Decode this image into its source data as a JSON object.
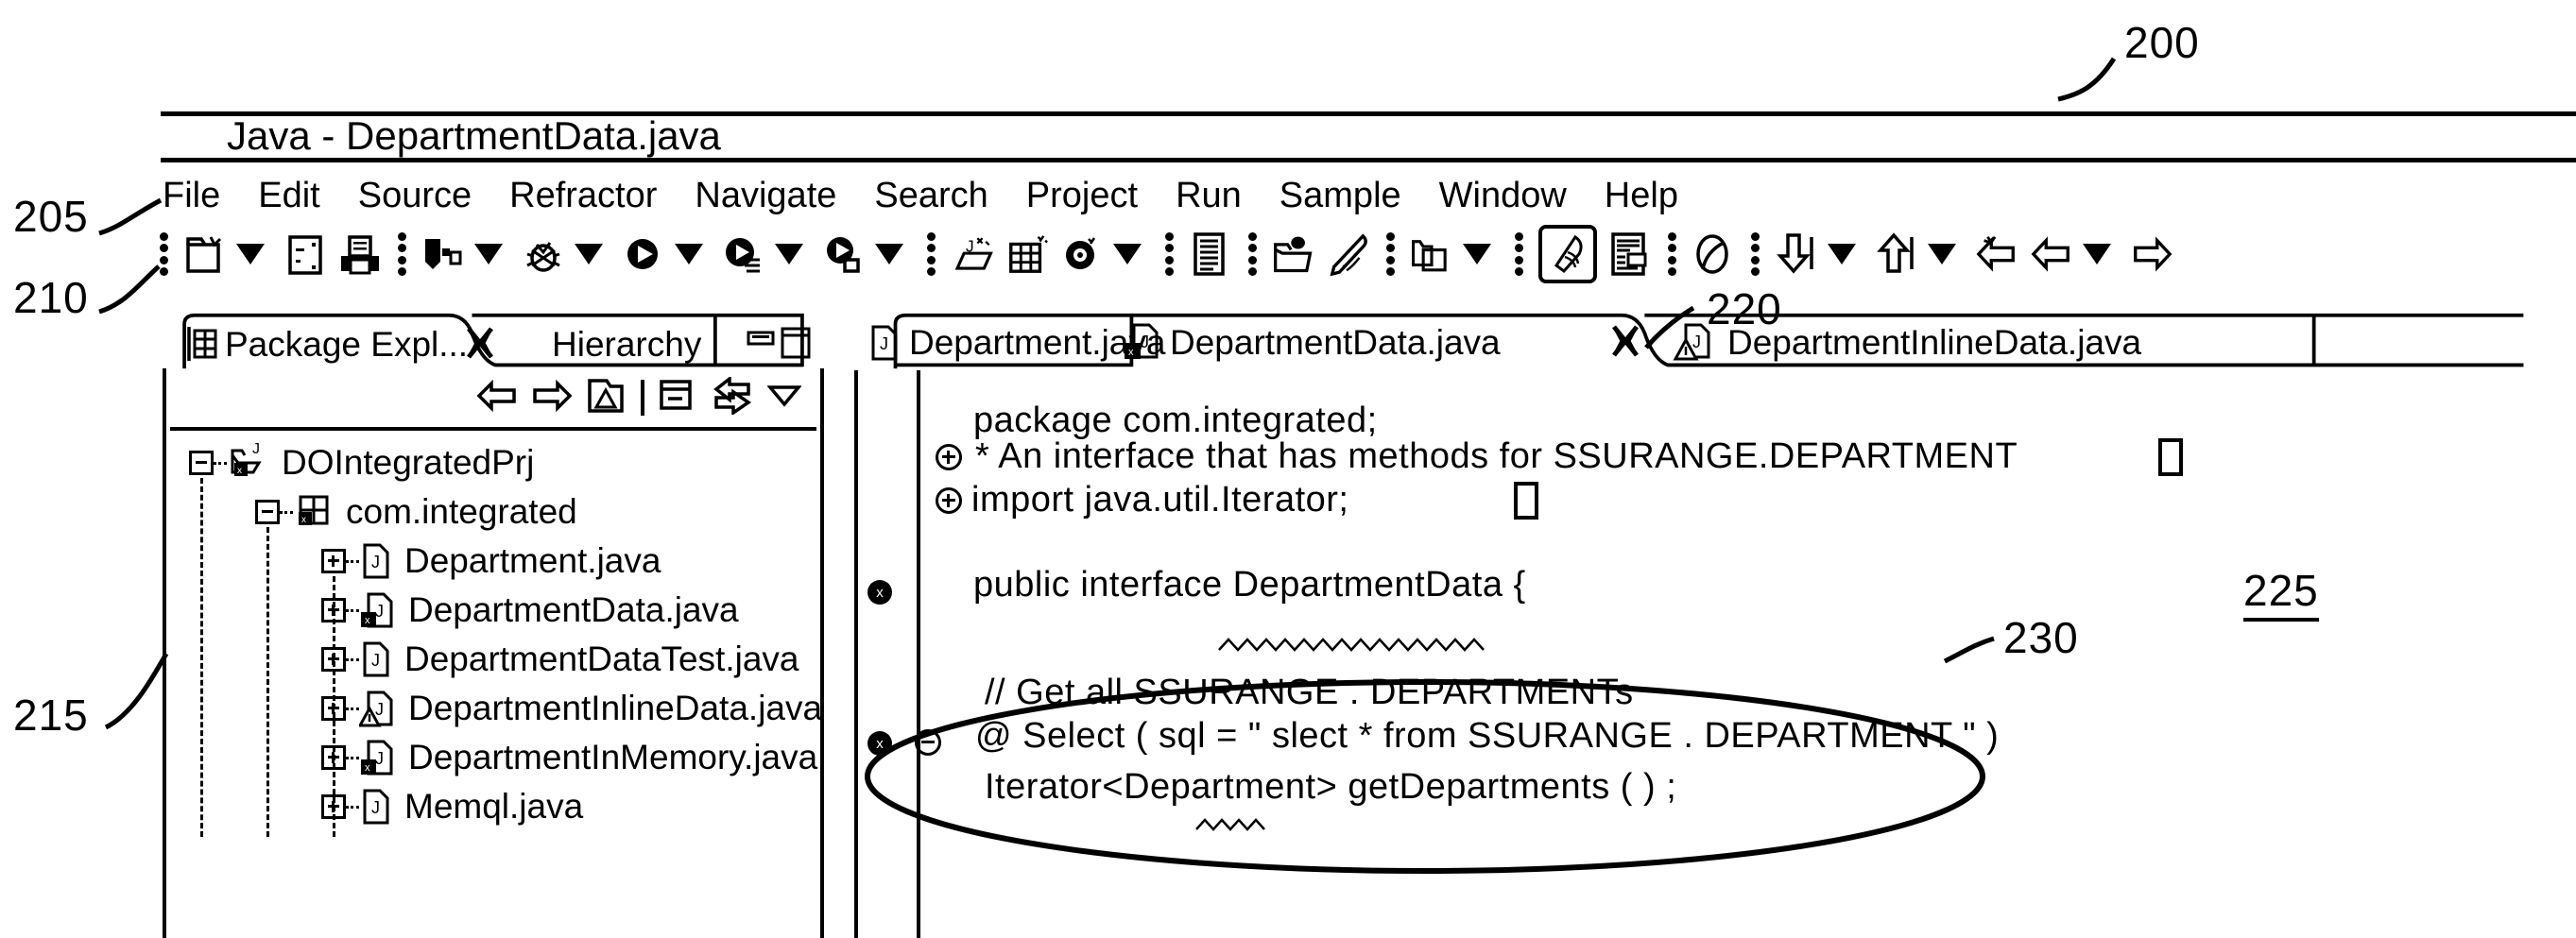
{
  "figure": {
    "refs": [
      {
        "id": "200",
        "label": "200"
      },
      {
        "id": "205",
        "label": "205"
      },
      {
        "id": "210",
        "label": "210"
      },
      {
        "id": "215",
        "label": "215"
      },
      {
        "id": "220",
        "label": "220"
      },
      {
        "id": "225",
        "label": "225"
      },
      {
        "id": "230",
        "label": "230"
      }
    ]
  },
  "window": {
    "title": "Java - DepartmentData.java"
  },
  "menubar": {
    "items": [
      {
        "label": "File"
      },
      {
        "label": "Edit"
      },
      {
        "label": "Source"
      },
      {
        "label": "Refractor"
      },
      {
        "label": "Navigate"
      },
      {
        "label": "Search"
      },
      {
        "label": "Project"
      },
      {
        "label": "Run"
      },
      {
        "label": "Sample"
      },
      {
        "label": "Window"
      },
      {
        "label": "Help"
      }
    ]
  },
  "toolbar": {
    "groups": [
      {
        "items": [
          {
            "icon": "new-wizard-icon",
            "dropdown": true
          },
          {
            "icon": "save-icon",
            "dropdown": false
          },
          {
            "icon": "print-icon",
            "dropdown": false
          }
        ]
      },
      {
        "items": [
          {
            "icon": "build-icon",
            "dropdown": true
          },
          {
            "icon": "debug-bug-icon",
            "dropdown": true
          },
          {
            "icon": "run-icon",
            "dropdown": true
          },
          {
            "icon": "run-external-tools-icon",
            "dropdown": true
          },
          {
            "icon": "profile-icon",
            "dropdown": true
          }
        ]
      },
      {
        "items": [
          {
            "icon": "new-java-class-icon",
            "dropdown": false
          },
          {
            "icon": "new-java-package-icon",
            "dropdown": false
          },
          {
            "icon": "search-target-icon",
            "dropdown": true
          },
          {
            "icon": "open-type-icon",
            "dropdown": false
          }
        ]
      },
      {
        "items": [
          {
            "icon": "open-folder-icon",
            "dropdown": false
          },
          {
            "icon": "pen-annotate-icon",
            "dropdown": false
          }
        ]
      },
      {
        "items": [
          {
            "icon": "open-resource-icon",
            "dropdown": true
          }
        ]
      },
      {
        "items": [
          {
            "icon": "highlighter-icon",
            "dropdown": false
          },
          {
            "icon": "document-list-icon",
            "dropdown": false
          }
        ]
      },
      {
        "items": [
          {
            "icon": "pie-toggle-icon",
            "dropdown": false
          }
        ]
      },
      {
        "items": [
          {
            "icon": "next-annotation-down-icon",
            "dropdown": true
          },
          {
            "icon": "prev-annotation-up-icon",
            "dropdown": true
          },
          {
            "icon": "back-new-icon",
            "dropdown": false
          },
          {
            "icon": "back-icon",
            "dropdown": true
          },
          {
            "icon": "forward-icon",
            "dropdown": false
          }
        ]
      }
    ]
  },
  "left_panel": {
    "tabs": [
      {
        "label": "Package Expl...",
        "icon": "package-explorer-icon",
        "active": true,
        "closeable": true
      },
      {
        "label": "Hierarchy",
        "icon": "hierarchy-icon",
        "active": false,
        "closeable": false
      }
    ],
    "view_buttons": [
      {
        "icon": "minimize-icon"
      },
      {
        "icon": "maximize-icon"
      }
    ],
    "toolbar_icons": [
      {
        "icon": "back-arrow-icon"
      },
      {
        "icon": "forward-arrow-icon"
      },
      {
        "icon": "home-collapse-icon"
      },
      {
        "icon": "collapse-all-icon"
      },
      {
        "icon": "link-with-editor-icon"
      },
      {
        "icon": "view-menu-icon"
      }
    ],
    "tree": [
      {
        "label": "DOIntegratedPrj",
        "depth": 0,
        "expander": "minus",
        "icon": "java-project-icon",
        "decorated": true
      },
      {
        "label": "com.integrated",
        "depth": 1,
        "expander": "minus",
        "icon": "package-icon",
        "decorated": true
      },
      {
        "label": "Department.java",
        "depth": 2,
        "expander": "plus",
        "icon": "java-file-icon",
        "decorated": false
      },
      {
        "label": "DepartmentData.java",
        "depth": 2,
        "expander": "plus",
        "icon": "java-file-error-icon",
        "decorated": true
      },
      {
        "label": "DepartmentDataTest.java",
        "depth": 2,
        "expander": "plus",
        "icon": "java-file-icon",
        "decorated": false
      },
      {
        "label": "DepartmentInlineData.java",
        "depth": 2,
        "expander": "plus",
        "icon": "java-file-warning-icon",
        "decorated": true
      },
      {
        "label": "DepartmentInMemory.java",
        "depth": 2,
        "expander": "plus",
        "icon": "java-file-error-icon",
        "decorated": true
      },
      {
        "label": "Memql.java",
        "depth": 2,
        "expander": "plus",
        "icon": "java-file-icon",
        "decorated": false
      }
    ]
  },
  "editor": {
    "tabs": [
      {
        "label": "Department.java",
        "icon": "java-file-icon",
        "active": false,
        "closeable": false
      },
      {
        "label": "DepartmentData.java",
        "icon": "java-file-error-icon",
        "active": true,
        "closeable": true
      },
      {
        "label": "DepartmentInlineData.java",
        "icon": "java-file-warning-icon",
        "active": false,
        "closeable": false
      }
    ],
    "code_lines": [
      {
        "text": "package  com.integrated;",
        "marker": "none",
        "fold": "none",
        "annotation": false
      },
      {
        "text": "* An  interface  that  has  methods  for  SSURANGE.DEPARTMENT",
        "marker": "none",
        "fold": "plus",
        "annotation": true
      },
      {
        "text": "import  java.util.Iterator;",
        "marker": "none",
        "fold": "plus",
        "annotation": true
      },
      {
        "text": "",
        "marker": "none",
        "fold": "none",
        "annotation": false
      },
      {
        "text": "public  interface  DepartmentData  {",
        "marker": "error",
        "fold": "none",
        "annotation": false,
        "squiggle": "DepartmentData"
      },
      {
        "text": "",
        "marker": "none",
        "fold": "none",
        "annotation": false
      },
      {
        "text": "// Get  all  SSURANGE . DEPARTMENTs",
        "marker": "none",
        "fold": "none",
        "annotation": false
      },
      {
        "text": "@ Select ( sql = \" slect  *  from  SSURANGE . DEPARTMENT \" )",
        "marker": "error",
        "fold": "minus",
        "annotation": false,
        "squiggle": "slect"
      },
      {
        "text": "Iterator<Department> getDepartments ( ) ;",
        "marker": "none",
        "fold": "none",
        "annotation": false
      }
    ]
  }
}
